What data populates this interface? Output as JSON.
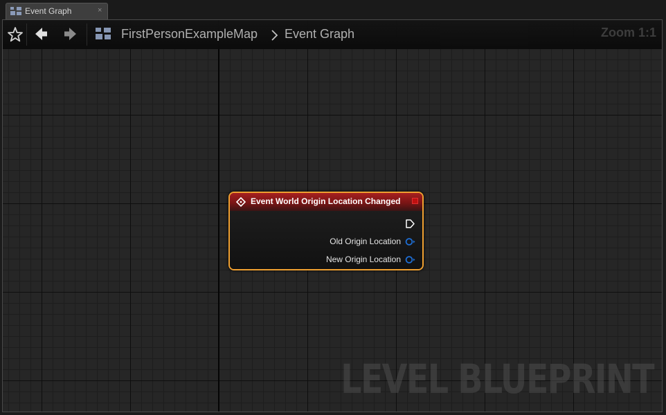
{
  "tab": {
    "label": "Event Graph",
    "close": "×",
    "icon": "graph-icon"
  },
  "toolbar": {
    "breadcrumb": [
      {
        "label": "FirstPersonExampleMap"
      },
      {
        "label": "Event Graph"
      }
    ],
    "separator": "›",
    "zoom_label": "Zoom 1:1"
  },
  "watermark": "LEVEL BLUEPRINT",
  "node": {
    "title": "Event World Origin Location Changed",
    "header_color": "#a52020",
    "border_color": "#f0a030",
    "pins": [
      {
        "label": "",
        "type": "exec-icon"
      },
      {
        "label": "Old Origin Location",
        "type": "vector-pin-icon"
      },
      {
        "label": "New Origin Location",
        "type": "vector-pin-icon"
      }
    ]
  },
  "colors": {
    "vector_pin": "#1e6fd6",
    "accent": "#f0a030"
  }
}
